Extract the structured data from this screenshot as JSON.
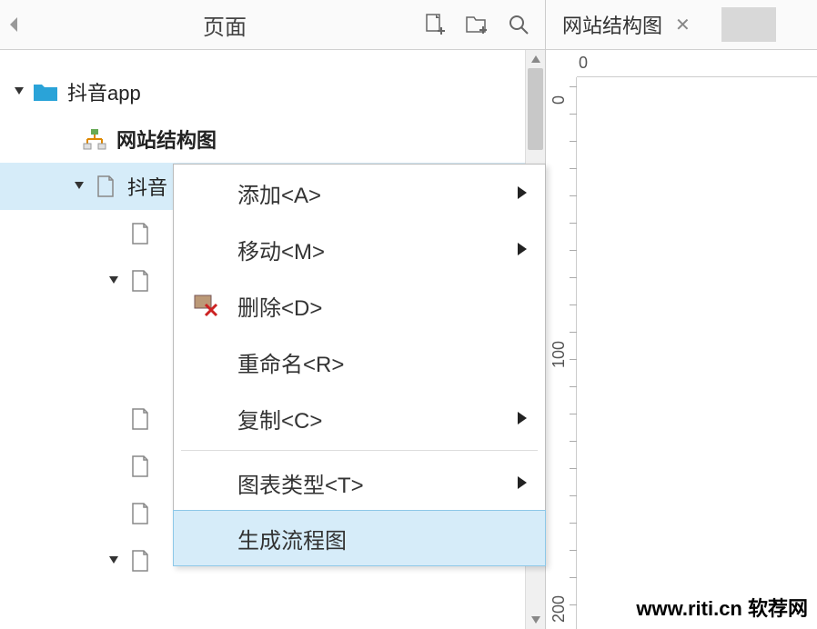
{
  "left_panel": {
    "title": "页面",
    "tree": {
      "root": {
        "label": "抖音app"
      },
      "sitemap": {
        "label": "网站结构图"
      },
      "selected": {
        "label": "抖音"
      }
    }
  },
  "context_menu": {
    "items": [
      {
        "label": "添加<A>",
        "has_submenu": true,
        "icon": null
      },
      {
        "label": "移动<M>",
        "has_submenu": true,
        "icon": null
      },
      {
        "label": "删除<D>",
        "has_submenu": false,
        "icon": "delete"
      },
      {
        "label": "重命名<R>",
        "has_submenu": false,
        "icon": null
      },
      {
        "label": "复制<C>",
        "has_submenu": true,
        "icon": null
      },
      {
        "label": "图表类型<T>",
        "has_submenu": true,
        "icon": null
      },
      {
        "label": "生成流程图",
        "has_submenu": false,
        "icon": null,
        "highlighted": true
      }
    ]
  },
  "right_panel": {
    "tab_title": "网站结构图",
    "ruler_h": [
      "0"
    ],
    "ruler_v": [
      "0",
      "100",
      "200"
    ]
  },
  "watermark": "www.riti.cn 软荐网"
}
